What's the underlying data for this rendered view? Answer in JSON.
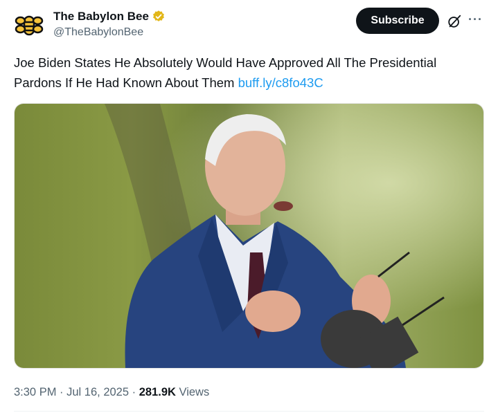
{
  "author": {
    "name": "The Babylon Bee",
    "handle": "@TheBabylonBee",
    "verified": true,
    "verified_color": "#e2b719"
  },
  "actions": {
    "subscribe_label": "Subscribe",
    "grok_icon": "grok-icon",
    "more_icon": "more-icon",
    "more_glyph": "···"
  },
  "post": {
    "text": "Joe Biden States He Absolutely Would Have Approved All The Presidential Pardons If He Had Known About Them ",
    "link": "buff.ly/c8fo43C",
    "link_color": "#1d9bf0",
    "image_description": "older man in blue suit speaking outdoors, holding sunglasses, microphone in foreground"
  },
  "meta": {
    "time": "3:30 PM",
    "separator1": " · ",
    "date": "Jul 16, 2025",
    "separator2": " · ",
    "views_count": "281.9K",
    "views_label": " Views"
  }
}
